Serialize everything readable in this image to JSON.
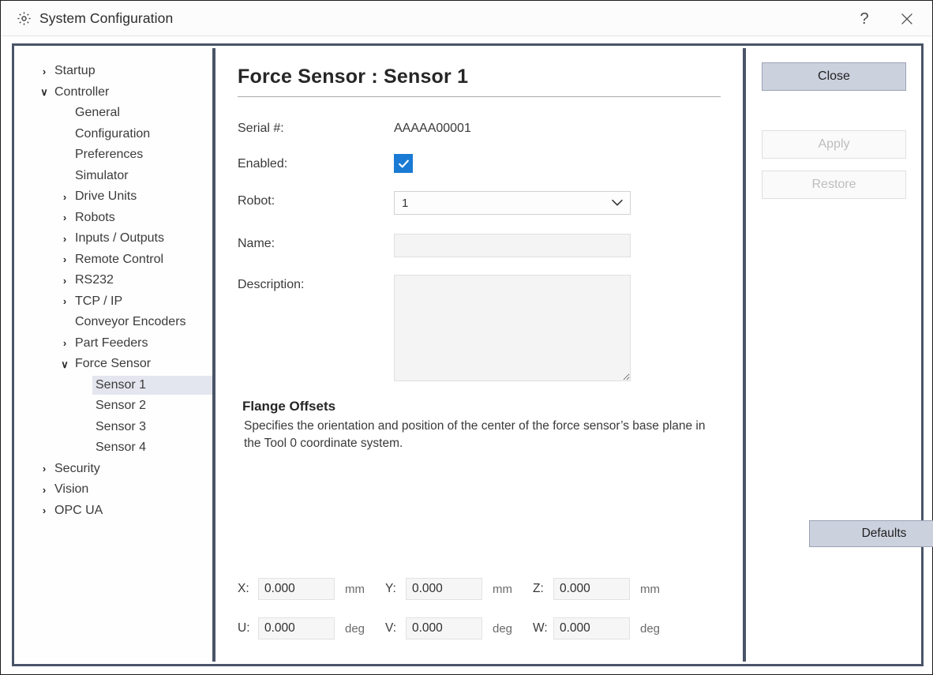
{
  "window": {
    "title": "System Configuration",
    "icon": "gear-icon",
    "help_label": "?",
    "close_label": "✕"
  },
  "sidebar": {
    "items": [
      {
        "label": "Startup",
        "level": 0,
        "chevron": "›",
        "expanded": false,
        "selected": false
      },
      {
        "label": "Controller",
        "level": 0,
        "chevron": "∨",
        "expanded": true,
        "selected": false
      },
      {
        "label": "General",
        "level": 1,
        "chevron": "",
        "expanded": null,
        "selected": false
      },
      {
        "label": "Configuration",
        "level": 1,
        "chevron": "",
        "expanded": null,
        "selected": false
      },
      {
        "label": "Preferences",
        "level": 1,
        "chevron": "",
        "expanded": null,
        "selected": false
      },
      {
        "label": "Simulator",
        "level": 1,
        "chevron": "",
        "expanded": null,
        "selected": false
      },
      {
        "label": "Drive Units",
        "level": 1,
        "chevron": "›",
        "expanded": false,
        "selected": false
      },
      {
        "label": "Robots",
        "level": 1,
        "chevron": "›",
        "expanded": false,
        "selected": false
      },
      {
        "label": "Inputs / Outputs",
        "level": 1,
        "chevron": "›",
        "expanded": false,
        "selected": false
      },
      {
        "label": "Remote Control",
        "level": 1,
        "chevron": "›",
        "expanded": false,
        "selected": false
      },
      {
        "label": "RS232",
        "level": 1,
        "chevron": "›",
        "expanded": false,
        "selected": false
      },
      {
        "label": "TCP / IP",
        "level": 1,
        "chevron": "›",
        "expanded": false,
        "selected": false
      },
      {
        "label": "Conveyor Encoders",
        "level": 1,
        "chevron": "",
        "expanded": null,
        "selected": false
      },
      {
        "label": "Part Feeders",
        "level": 1,
        "chevron": "›",
        "expanded": false,
        "selected": false
      },
      {
        "label": "Force Sensor",
        "level": 1,
        "chevron": "∨",
        "expanded": true,
        "selected": false
      },
      {
        "label": "Sensor 1",
        "level": 2,
        "chevron": "",
        "expanded": null,
        "selected": true
      },
      {
        "label": "Sensor 2",
        "level": 2,
        "chevron": "",
        "expanded": null,
        "selected": false
      },
      {
        "label": "Sensor 3",
        "level": 2,
        "chevron": "",
        "expanded": null,
        "selected": false
      },
      {
        "label": "Sensor 4",
        "level": 2,
        "chevron": "",
        "expanded": null,
        "selected": false
      },
      {
        "label": "Security",
        "level": 0,
        "chevron": "›",
        "expanded": false,
        "selected": false
      },
      {
        "label": "Vision",
        "level": 0,
        "chevron": "›",
        "expanded": false,
        "selected": false
      },
      {
        "label": "OPC UA",
        "level": 0,
        "chevron": "›",
        "expanded": false,
        "selected": false
      }
    ]
  },
  "main": {
    "title": "Force Sensor : Sensor 1",
    "fields": {
      "serial_label": "Serial #:",
      "serial_value": "AAAAA00001",
      "enabled_label": "Enabled:",
      "enabled_checked": true,
      "robot_label": "Robot:",
      "robot_value": "1",
      "robot_options": [
        "1"
      ],
      "name_label": "Name:",
      "name_value": "",
      "name_placeholder": "",
      "description_label": "Description:",
      "description_value": "",
      "description_placeholder": ""
    },
    "flange": {
      "heading": "Flange Offsets",
      "description": "Specifies the orientation and position of the center of the force sensor’s base plane in the Tool 0 coordinate system.",
      "defaults_label": "Defaults",
      "coords": [
        {
          "label": "X:",
          "value": "0.000",
          "unit": "mm"
        },
        {
          "label": "Y:",
          "value": "0.000",
          "unit": "mm"
        },
        {
          "label": "Z:",
          "value": "0.000",
          "unit": "mm"
        },
        {
          "label": "U:",
          "value": "0.000",
          "unit": "deg"
        },
        {
          "label": "V:",
          "value": "0.000",
          "unit": "deg"
        },
        {
          "label": "W:",
          "value": "0.000",
          "unit": "deg"
        }
      ]
    }
  },
  "actions": {
    "close_label": "Close",
    "apply_label": "Apply",
    "apply_enabled": false,
    "restore_label": "Restore",
    "restore_enabled": false
  },
  "colors": {
    "accent_checkbox": "#1a7ad4",
    "frame_border": "#4a5468",
    "button_primary": "#ccd1de",
    "selection": "#e3e6ee"
  }
}
